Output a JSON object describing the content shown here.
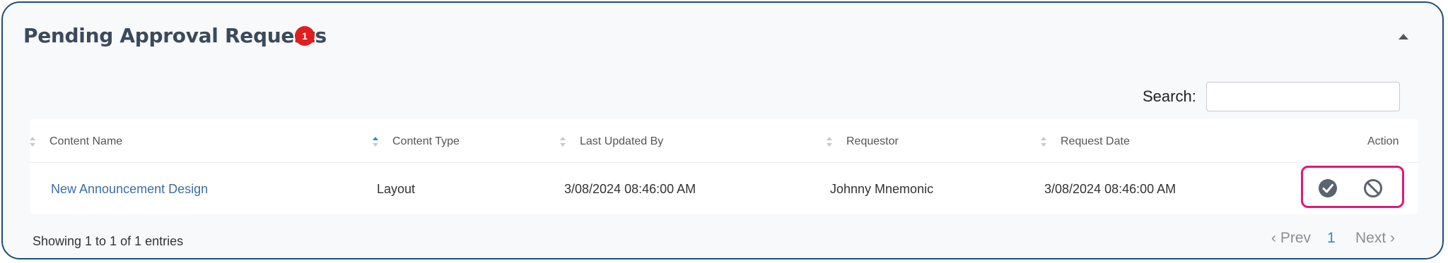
{
  "panel": {
    "title": "Pending Approval Requests",
    "badge_count": "1",
    "collapse_icon": "chevron-up-icon"
  },
  "search": {
    "label": "Search:",
    "value": "",
    "placeholder": ""
  },
  "table": {
    "columns": [
      {
        "label": "Content Name",
        "sorted": false
      },
      {
        "label": "Content Type",
        "sorted": true
      },
      {
        "label": "Last Updated By",
        "sorted": false
      },
      {
        "label": "Requestor",
        "sorted": false
      },
      {
        "label": "Request Date",
        "sorted": false
      },
      {
        "label": "Action",
        "sorted": false
      }
    ],
    "rows": [
      {
        "content_name": "New Announcement Design",
        "content_type": "Layout",
        "last_updated_by": "3/08/2024 08:46:00 AM",
        "requestor": "Johnny Mnemonic",
        "request_date": "3/08/2024 08:46:00 AM",
        "actions": [
          "approve-icon",
          "reject-icon"
        ]
      }
    ]
  },
  "footer": {
    "entries_text": "Showing 1 to 1 of 1 entries",
    "prev_label": "‹ Prev",
    "current_page": "1",
    "next_label": "Next ›"
  },
  "colors": {
    "badge": "#e01e1e",
    "link": "#3a6ea5",
    "highlight": "#e0187a",
    "accent": "#2a8ad4",
    "border": "#1f4e79"
  }
}
